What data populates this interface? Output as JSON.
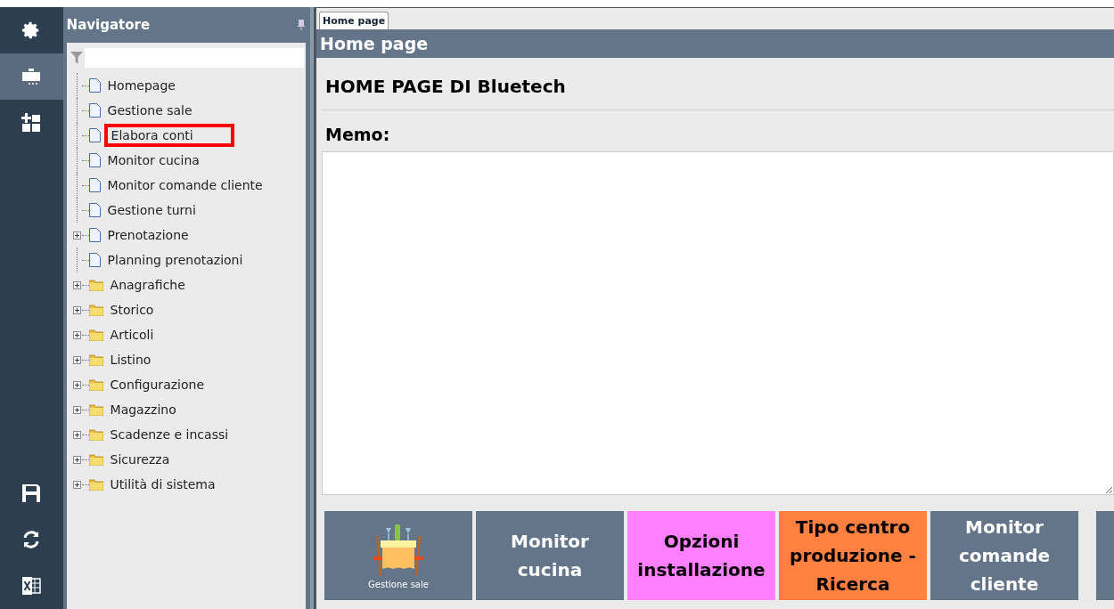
{
  "rail": {
    "items": [
      {
        "kind": "settings",
        "selected": false
      },
      {
        "kind": "desk",
        "selected": true
      },
      {
        "kind": "add-grid",
        "selected": false
      }
    ],
    "bottom_items": [
      {
        "kind": "save"
      },
      {
        "kind": "refresh"
      },
      {
        "kind": "excel"
      }
    ]
  },
  "navigator": {
    "title": "Navigatore",
    "items": [
      {
        "label": "Homepage",
        "kind": "page",
        "expandable": false,
        "highlighted": false
      },
      {
        "label": "Gestione sale",
        "kind": "page",
        "expandable": false,
        "highlighted": false
      },
      {
        "label": "Elabora conti",
        "kind": "page",
        "expandable": false,
        "highlighted": true
      },
      {
        "label": "Monitor cucina",
        "kind": "page",
        "expandable": false,
        "highlighted": false
      },
      {
        "label": "Monitor comande cliente",
        "kind": "page",
        "expandable": false,
        "highlighted": false
      },
      {
        "label": "Gestione turni",
        "kind": "page",
        "expandable": false,
        "highlighted": false
      },
      {
        "label": "Prenotazione",
        "kind": "page",
        "expandable": true,
        "highlighted": false
      },
      {
        "label": "Planning prenotazioni",
        "kind": "page",
        "expandable": false,
        "highlighted": false
      },
      {
        "label": "Anagrafiche",
        "kind": "folder",
        "expandable": true,
        "highlighted": false
      },
      {
        "label": "Storico",
        "kind": "folder",
        "expandable": true,
        "highlighted": false
      },
      {
        "label": "Articoli",
        "kind": "folder",
        "expandable": true,
        "highlighted": false
      },
      {
        "label": "Listino",
        "kind": "folder",
        "expandable": true,
        "highlighted": false
      },
      {
        "label": "Configurazione",
        "kind": "folder",
        "expandable": true,
        "highlighted": false
      },
      {
        "label": "Magazzino",
        "kind": "folder",
        "expandable": true,
        "highlighted": false
      },
      {
        "label": "Scadenze e incassi",
        "kind": "folder",
        "expandable": true,
        "highlighted": false
      },
      {
        "label": "Sicurezza",
        "kind": "folder",
        "expandable": true,
        "highlighted": false
      },
      {
        "label": "Utilità di sistema",
        "kind": "folder",
        "expandable": true,
        "highlighted": false
      }
    ]
  },
  "tabs": [
    {
      "label": "Home page",
      "selected": true
    }
  ],
  "page": {
    "header": "Home page",
    "title": "HOME PAGE DI Bluetech",
    "memo_label": "Memo:",
    "tiles": [
      {
        "kind": "image",
        "label": "Gestione sale",
        "color": "#64758a"
      },
      {
        "kind": "text",
        "label": "Monitor cucina",
        "color": "#64758a"
      },
      {
        "kind": "text",
        "label": "Opzioni installazione",
        "color": "#ff80ff"
      },
      {
        "kind": "text",
        "label": "Tipo centro produzione - Ricerca",
        "color": "#ff8040"
      },
      {
        "kind": "text",
        "label": "Monitor comande cliente",
        "color": "#64758a"
      }
    ]
  }
}
